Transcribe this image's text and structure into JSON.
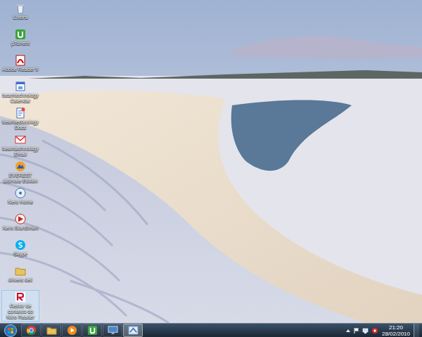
{
  "desktop": {
    "icons": [
      {
        "label": "Lixeira",
        "kind": "recycle",
        "selected": false
      },
      {
        "label": "µTorrent",
        "kind": "utorrent",
        "selected": false
      },
      {
        "label": "Adobe Reader 9",
        "kind": "pdf",
        "selected": false
      },
      {
        "label": "beamtechnology Calendar",
        "kind": "calendar",
        "selected": false
      },
      {
        "label": "beamtechnology Docs",
        "kind": "docs",
        "selected": false
      },
      {
        "label": "beamtechnology Email",
        "kind": "mail",
        "selected": false
      },
      {
        "label": "EVEREST Ultimate Edition",
        "kind": "everest",
        "selected": false
      },
      {
        "label": "Nero Home",
        "kind": "nero",
        "selected": false
      },
      {
        "label": "Nero StartSmart",
        "kind": "nerostart",
        "selected": false
      },
      {
        "label": "Skype",
        "kind": "skype",
        "selected": false
      },
      {
        "label": "drivers dell",
        "kind": "folder",
        "selected": false
      },
      {
        "label": "Gestor de contexto do Nitro Reader",
        "kind": "reader",
        "selected": true
      }
    ]
  },
  "taskbar": {
    "items": [
      {
        "kind": "chrome",
        "active": false
      },
      {
        "kind": "explorer",
        "active": false
      },
      {
        "kind": "media",
        "active": false
      },
      {
        "kind": "utorrent",
        "active": false
      },
      {
        "kind": "network",
        "active": false
      },
      {
        "kind": "app",
        "active": true
      }
    ],
    "clock": {
      "time": "21:20",
      "date": "28/02/2010"
    }
  }
}
